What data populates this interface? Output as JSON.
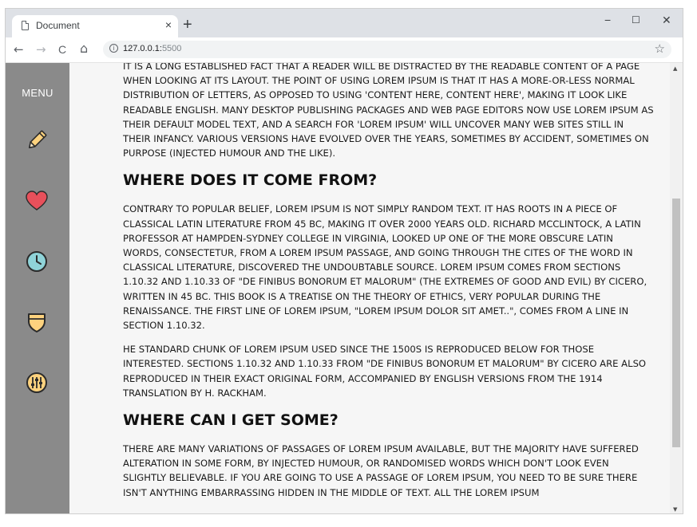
{
  "browser": {
    "tab_title": "Document",
    "tab_close": "×",
    "new_tab": "+",
    "url_host": "127.0.0.1:",
    "url_port": "5500",
    "window_controls": {
      "minimize": "−",
      "maximize": "☐",
      "close": "✕"
    },
    "nav": {
      "back": "←",
      "forward": "→",
      "reload": "C",
      "home": "⌂"
    },
    "star": "☆"
  },
  "sidebar": {
    "menu_label": "MENU",
    "items": [
      {
        "icon": "pencil-icon",
        "color": "#fdd27e"
      },
      {
        "icon": "heart-icon",
        "color": "#e8505b"
      },
      {
        "icon": "clock-icon",
        "color": "#8fd3d8"
      },
      {
        "icon": "shield-icon",
        "color": "#fdd27e"
      },
      {
        "icon": "equalizer-icon",
        "color": "#fdd27e"
      }
    ]
  },
  "article": {
    "intro": "It is a long established fact that a reader will be distracted by the readable content of a page when looking at its layout. The point of using Lorem Ipsum is that it has a more-or-less normal distribution of letters, as opposed to using 'Content here, content here', making it look like readable English. Many desktop publishing packages and web page editors now use Lorem Ipsum as their default model text, and a search for 'lorem ipsum' will uncover many web sites still in their infancy. Various versions have evolved over the years, sometimes by accident, sometimes on purpose (injected humour and the like).",
    "heading1": "Where does it come from?",
    "para1": "Contrary to popular belief, Lorem Ipsum is not simply random text. It has roots in a piece of classical Latin literature from 45 BC, making it over 2000 years old. Richard McClintock, a Latin professor at Hampden-Sydney College in Virginia, looked up one of the more obscure Latin words, consectetur, from a Lorem Ipsum passage, and going through the cites of the word in classical literature, discovered the undoubtable source. Lorem Ipsum comes from sections 1.10.32 and 1.10.33 of \"de Finibus Bonorum et Malorum\" (The Extremes of Good and Evil) by Cicero, written in 45 BC. This book is a treatise on the theory of ethics, very popular during the Renaissance. The first line of Lorem Ipsum, \"Lorem ipsum dolor sit amet..\", comes from a line in section 1.10.32.",
    "para2": "he standard chunk of Lorem Ipsum used since the 1500s is reproduced below for those interested. Sections 1.10.32 and 1.10.33 from \"de Finibus Bonorum et Malorum\" by Cicero are also reproduced in their exact original form, accompanied by English versions from the 1914 translation by H. Rackham.",
    "heading2": "Where can I get some?",
    "para3": "There are many variations of passages of Lorem Ipsum available, but the majority have suffered alteration in some form, by injected humour, or randomised words which don't look even slightly believable. If you are going to use a passage of Lorem Ipsum, you need to be sure there isn't anything embarrassing hidden in the middle of text. All the Lorem Ipsum"
  },
  "scrollbar": {
    "up": "▲",
    "down": "▼",
    "position": 0.35
  }
}
